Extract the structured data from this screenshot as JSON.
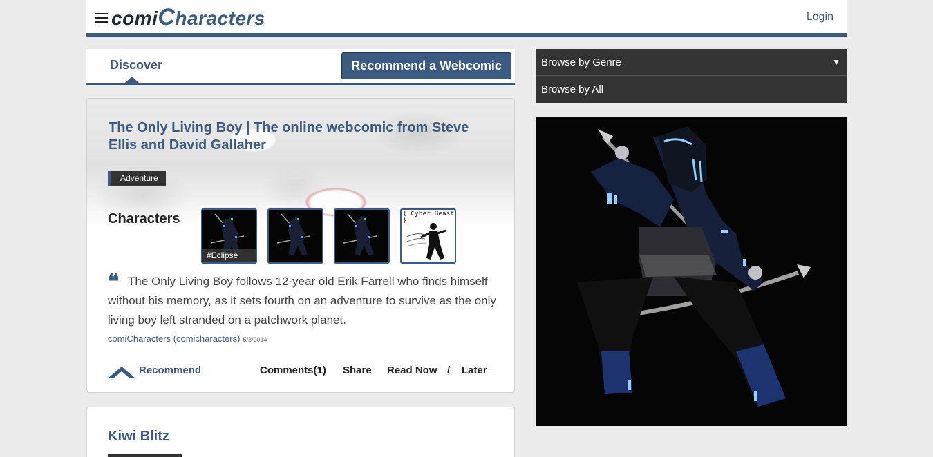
{
  "header": {
    "logo_part1": "comi",
    "logo_part2": "C",
    "logo_part3": "haracters",
    "login_label": "Login"
  },
  "discover": {
    "tab_label": "Discover",
    "recommend_button": "Recommend a Webcomic"
  },
  "card": {
    "title": "The Only Living Boy | The online webcomic from Steve Ellis and David Gallaher",
    "genre": "Adventure",
    "characters_label": "Characters",
    "characters": [
      {
        "caption": "#Eclipse"
      },
      {
        "caption": ""
      },
      {
        "caption": ""
      },
      {
        "caption": "{ Cyber.Beast }"
      }
    ],
    "quote_mark": "❝",
    "description": "The Only Living Boy follows 12-year old Erik Farrell who finds himself without his memory, as it sets fourth on an adventure to survive as the only living boy left stranded on a patchwork planet.",
    "author": "comiCharacters (comicharacters)",
    "date": "5/3/2014",
    "recommend_label": "Recommend",
    "actions": {
      "comments": "Comments(1)",
      "share": "Share",
      "read_now": "Read Now",
      "separator": "/",
      "later": "Later"
    }
  },
  "card2": {
    "title": "Kiwi Blitz"
  },
  "sidebar": {
    "browse_genre": "Browse by Genre",
    "browse_genre_arrow": "▼",
    "browse_all": "Browse by All"
  },
  "colors": {
    "accent": "#3c5b82",
    "dark_bar": "#333333",
    "background": "#ebebeb"
  }
}
